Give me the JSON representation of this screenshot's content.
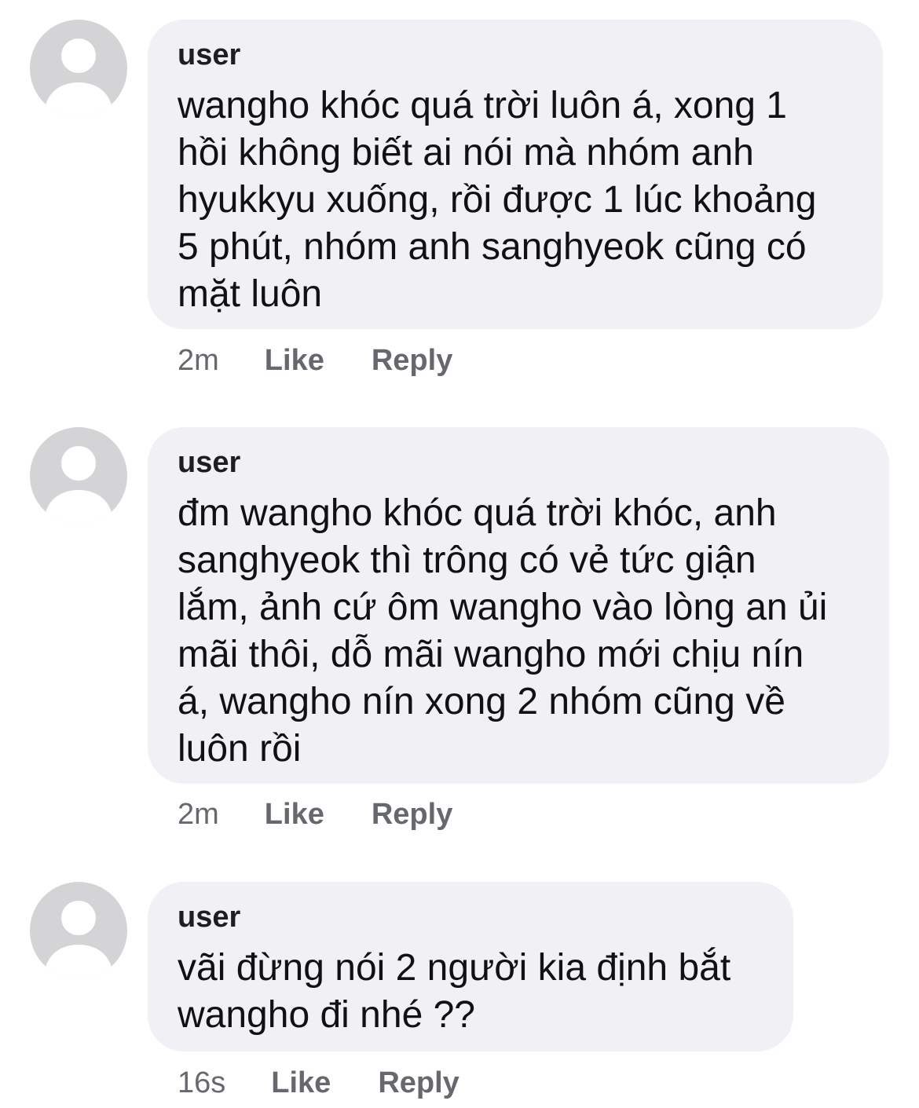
{
  "comments": [
    {
      "author": "user",
      "text": "wangho khóc quá trời luôn á, xong 1\nhồi không biết ai nói mà nhóm anh\nhyukkyu xuống, rồi được 1 lúc khoảng\n5 phút, nhóm anh sanghyeok cũng có\nmặt luôn",
      "time": "2m",
      "like_label": "Like",
      "reply_label": "Reply"
    },
    {
      "author": "user",
      "text": "đm wangho khóc quá trời khóc, anh\nsanghyeok thì trông có vẻ tức giận\nlắm, ảnh cứ ôm wangho vào lòng an ủi\nmãi thôi, dỗ mãi wangho mới chịu nín\ná, wangho nín xong 2 nhóm cũng về\nluôn rồi",
      "time": "2m",
      "like_label": "Like",
      "reply_label": "Reply"
    },
    {
      "author": "user",
      "text": "vãi đừng nói 2 người kia định bắt\nwangho đi nhé ??",
      "time": "16s",
      "like_label": "Like",
      "reply_label": "Reply"
    }
  ],
  "colors": {
    "bubble": "#f0f0f5",
    "avatar_bg": "#d4d4d6",
    "avatar_fg": "#ffffff",
    "action_text": "#66686d"
  },
  "icons": {
    "avatar": "default-user-silhouette-icon"
  }
}
